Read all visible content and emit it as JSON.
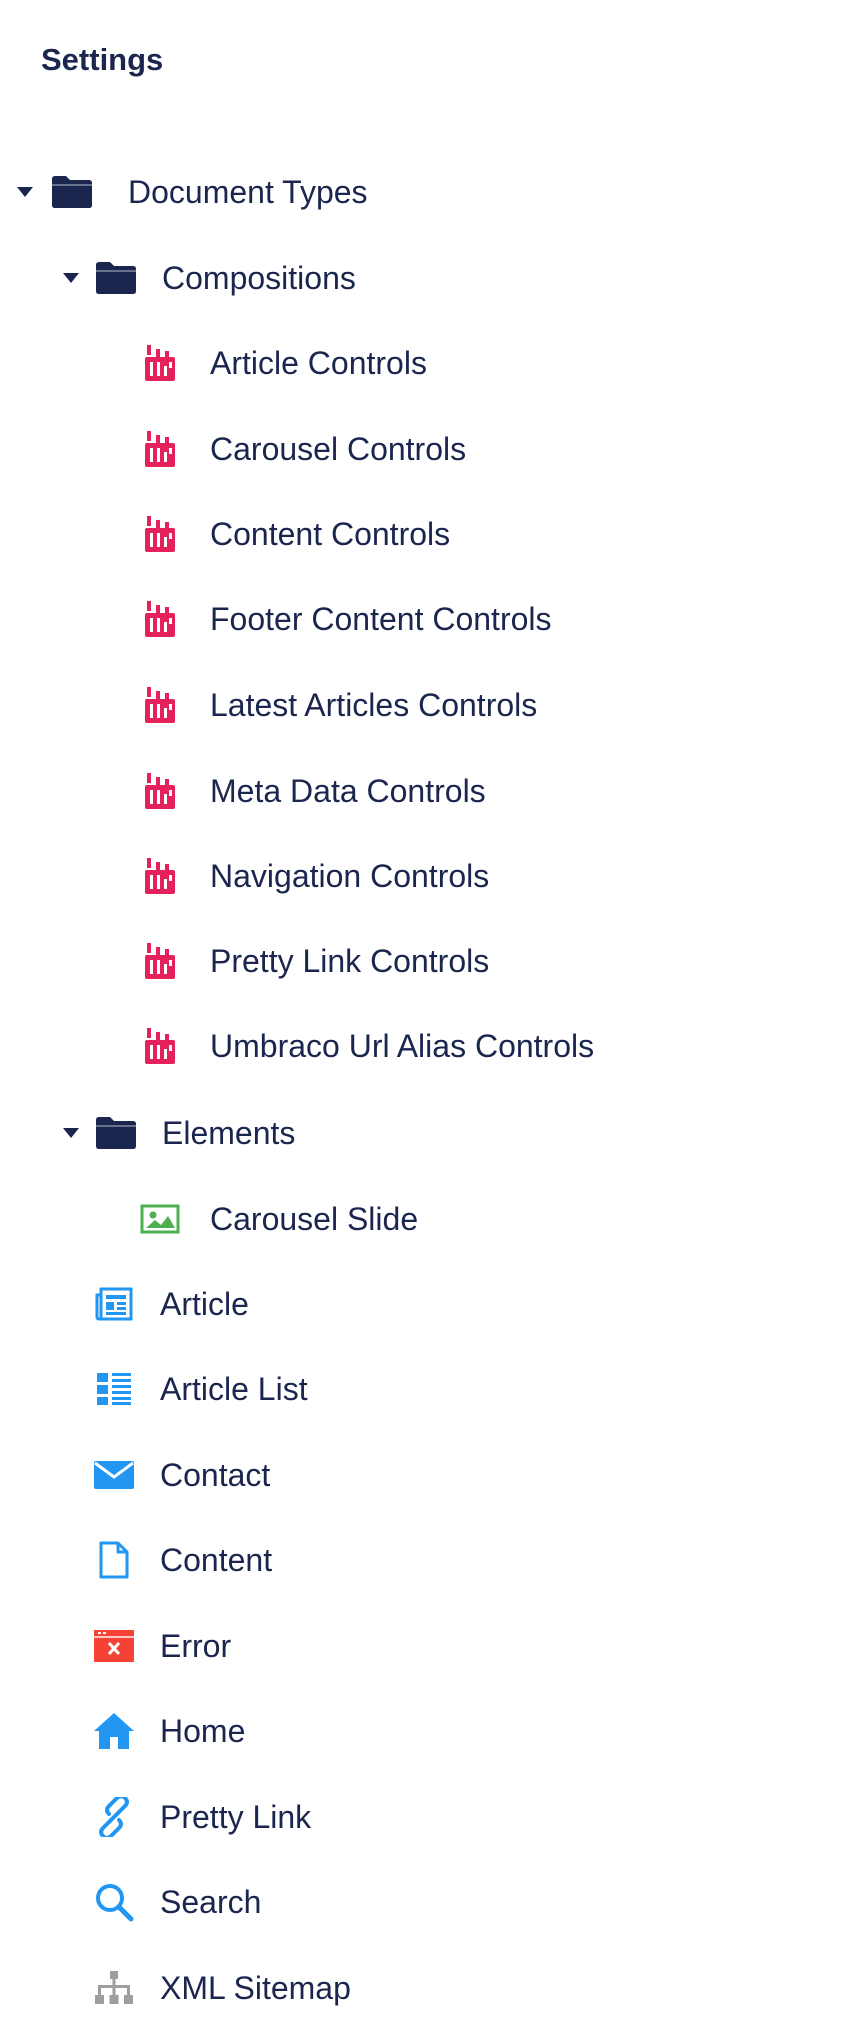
{
  "header": {
    "title": "Settings"
  },
  "tree": {
    "document_types": {
      "label": "Document Types",
      "icon": "folder-icon",
      "color": "#1b264f"
    },
    "compositions": {
      "label": "Compositions",
      "icon": "folder-icon",
      "color": "#1b264f",
      "items": [
        {
          "label": "Article Controls",
          "icon": "composition-icon",
          "color": "#e5215b"
        },
        {
          "label": "Carousel Controls",
          "icon": "composition-icon",
          "color": "#e5215b"
        },
        {
          "label": "Content Controls",
          "icon": "composition-icon",
          "color": "#e5215b"
        },
        {
          "label": "Footer Content Controls",
          "icon": "composition-icon",
          "color": "#e5215b"
        },
        {
          "label": "Latest Articles Controls",
          "icon": "composition-icon",
          "color": "#e5215b"
        },
        {
          "label": "Meta Data Controls",
          "icon": "composition-icon",
          "color": "#e5215b"
        },
        {
          "label": "Navigation Controls",
          "icon": "composition-icon",
          "color": "#e5215b"
        },
        {
          "label": "Pretty Link Controls",
          "icon": "composition-icon",
          "color": "#e5215b"
        },
        {
          "label": "Umbraco Url Alias Controls",
          "icon": "composition-icon",
          "color": "#e5215b"
        }
      ]
    },
    "elements": {
      "label": "Elements",
      "icon": "folder-icon",
      "color": "#1b264f",
      "items": [
        {
          "label": "Carousel Slide",
          "icon": "picture-icon",
          "color": "#4caf50"
        }
      ]
    },
    "document_items": [
      {
        "label": "Article",
        "icon": "newspaper-icon",
        "color": "#2196f3"
      },
      {
        "label": "Article List",
        "icon": "list-icon",
        "color": "#2196f3"
      },
      {
        "label": "Contact",
        "icon": "envelope-icon",
        "color": "#2196f3"
      },
      {
        "label": "Content",
        "icon": "document-icon",
        "color": "#2196f3"
      },
      {
        "label": "Error",
        "icon": "error-window-icon",
        "color": "#f44336"
      },
      {
        "label": "Home",
        "icon": "home-icon",
        "color": "#2196f3"
      },
      {
        "label": "Pretty Link",
        "icon": "link-icon",
        "color": "#2196f3"
      },
      {
        "label": "Search",
        "icon": "search-icon",
        "color": "#2196f3"
      },
      {
        "label": "XML Sitemap",
        "icon": "sitemap-icon",
        "color": "#9e9e9e"
      }
    ]
  }
}
